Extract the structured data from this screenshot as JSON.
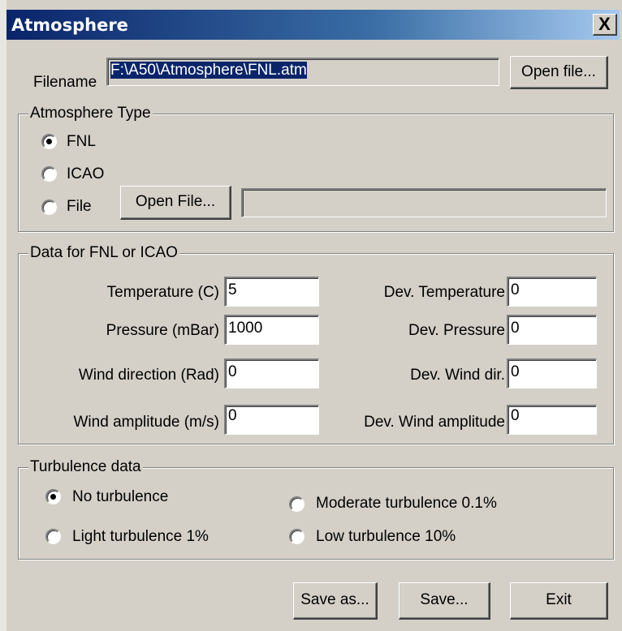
{
  "window": {
    "title": "Atmosphere",
    "close_label": "X"
  },
  "filename": {
    "label": "Filename",
    "value": "F:\\A50\\Atmosphere\\FNL.atm",
    "open_button": "Open file..."
  },
  "atmosphere_type": {
    "title": "Atmosphere Type",
    "options": [
      {
        "label": "FNL",
        "checked": true
      },
      {
        "label": "ICAO",
        "checked": false
      },
      {
        "label": "File",
        "checked": false
      }
    ],
    "open_file_button": "Open File...",
    "file_path": ""
  },
  "fnl_data": {
    "title": "Data for FNL or ICAO",
    "fields": [
      {
        "label": "Temperature  (C)",
        "value": "5"
      },
      {
        "label": "Pressure  (mBar)",
        "value": "1000"
      },
      {
        "label": "Wind direction   (Rad)",
        "value": "0"
      },
      {
        "label": "Wind amplitude  (m/s)",
        "value": "0"
      }
    ],
    "dev_fields": [
      {
        "label": "Dev. Temperature",
        "value": "0"
      },
      {
        "label": "Dev. Pressure",
        "value": "0"
      },
      {
        "label": "Dev. Wind dir.",
        "value": "0"
      },
      {
        "label": "Dev. Wind amplitude",
        "value": "0"
      }
    ]
  },
  "turbulence": {
    "title": "Turbulence data",
    "options": [
      {
        "label": "No turbulence",
        "checked": true
      },
      {
        "label": "Moderate turbulence 0.1%",
        "checked": false
      },
      {
        "label": "Light turbulence 1%",
        "checked": false
      },
      {
        "label": "Low turbulence 10%",
        "checked": false
      }
    ]
  },
  "buttons": {
    "save_as": "Save as...",
    "save": "Save...",
    "exit": "Exit"
  }
}
